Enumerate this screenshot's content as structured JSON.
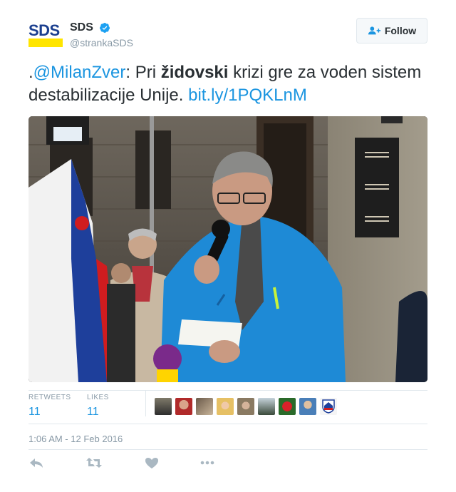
{
  "account": {
    "avatar_text": "SDS",
    "display_name": "SDS",
    "handle": "@strankaSDS",
    "follow_label": "Follow"
  },
  "tweet": {
    "prefix": ".",
    "mention": "@MilanZver",
    "text_before_bold": ": Pri ",
    "bold_word": "židovski",
    "text_after_bold": " krizi gre za voden sistem destabilizacije Unije. ",
    "link": "bit.ly/1PQKLnM"
  },
  "stats": {
    "retweets_label": "RETWEETS",
    "retweets_value": "11",
    "likes_label": "LIKES",
    "likes_value": "11"
  },
  "timestamp": "1:06 AM - 12 Feb 2016",
  "colors": {
    "link": "#1b95e0",
    "brand_blue": "#1b3f8f",
    "brand_yellow": "#ffe500",
    "jacket_blue": "#1e8ad6"
  },
  "icons": {
    "verified": "verified-badge-icon",
    "follow": "add-user-icon",
    "reply": "reply-icon",
    "retweet": "retweet-icon",
    "like": "heart-icon",
    "more": "more-dots-icon"
  }
}
